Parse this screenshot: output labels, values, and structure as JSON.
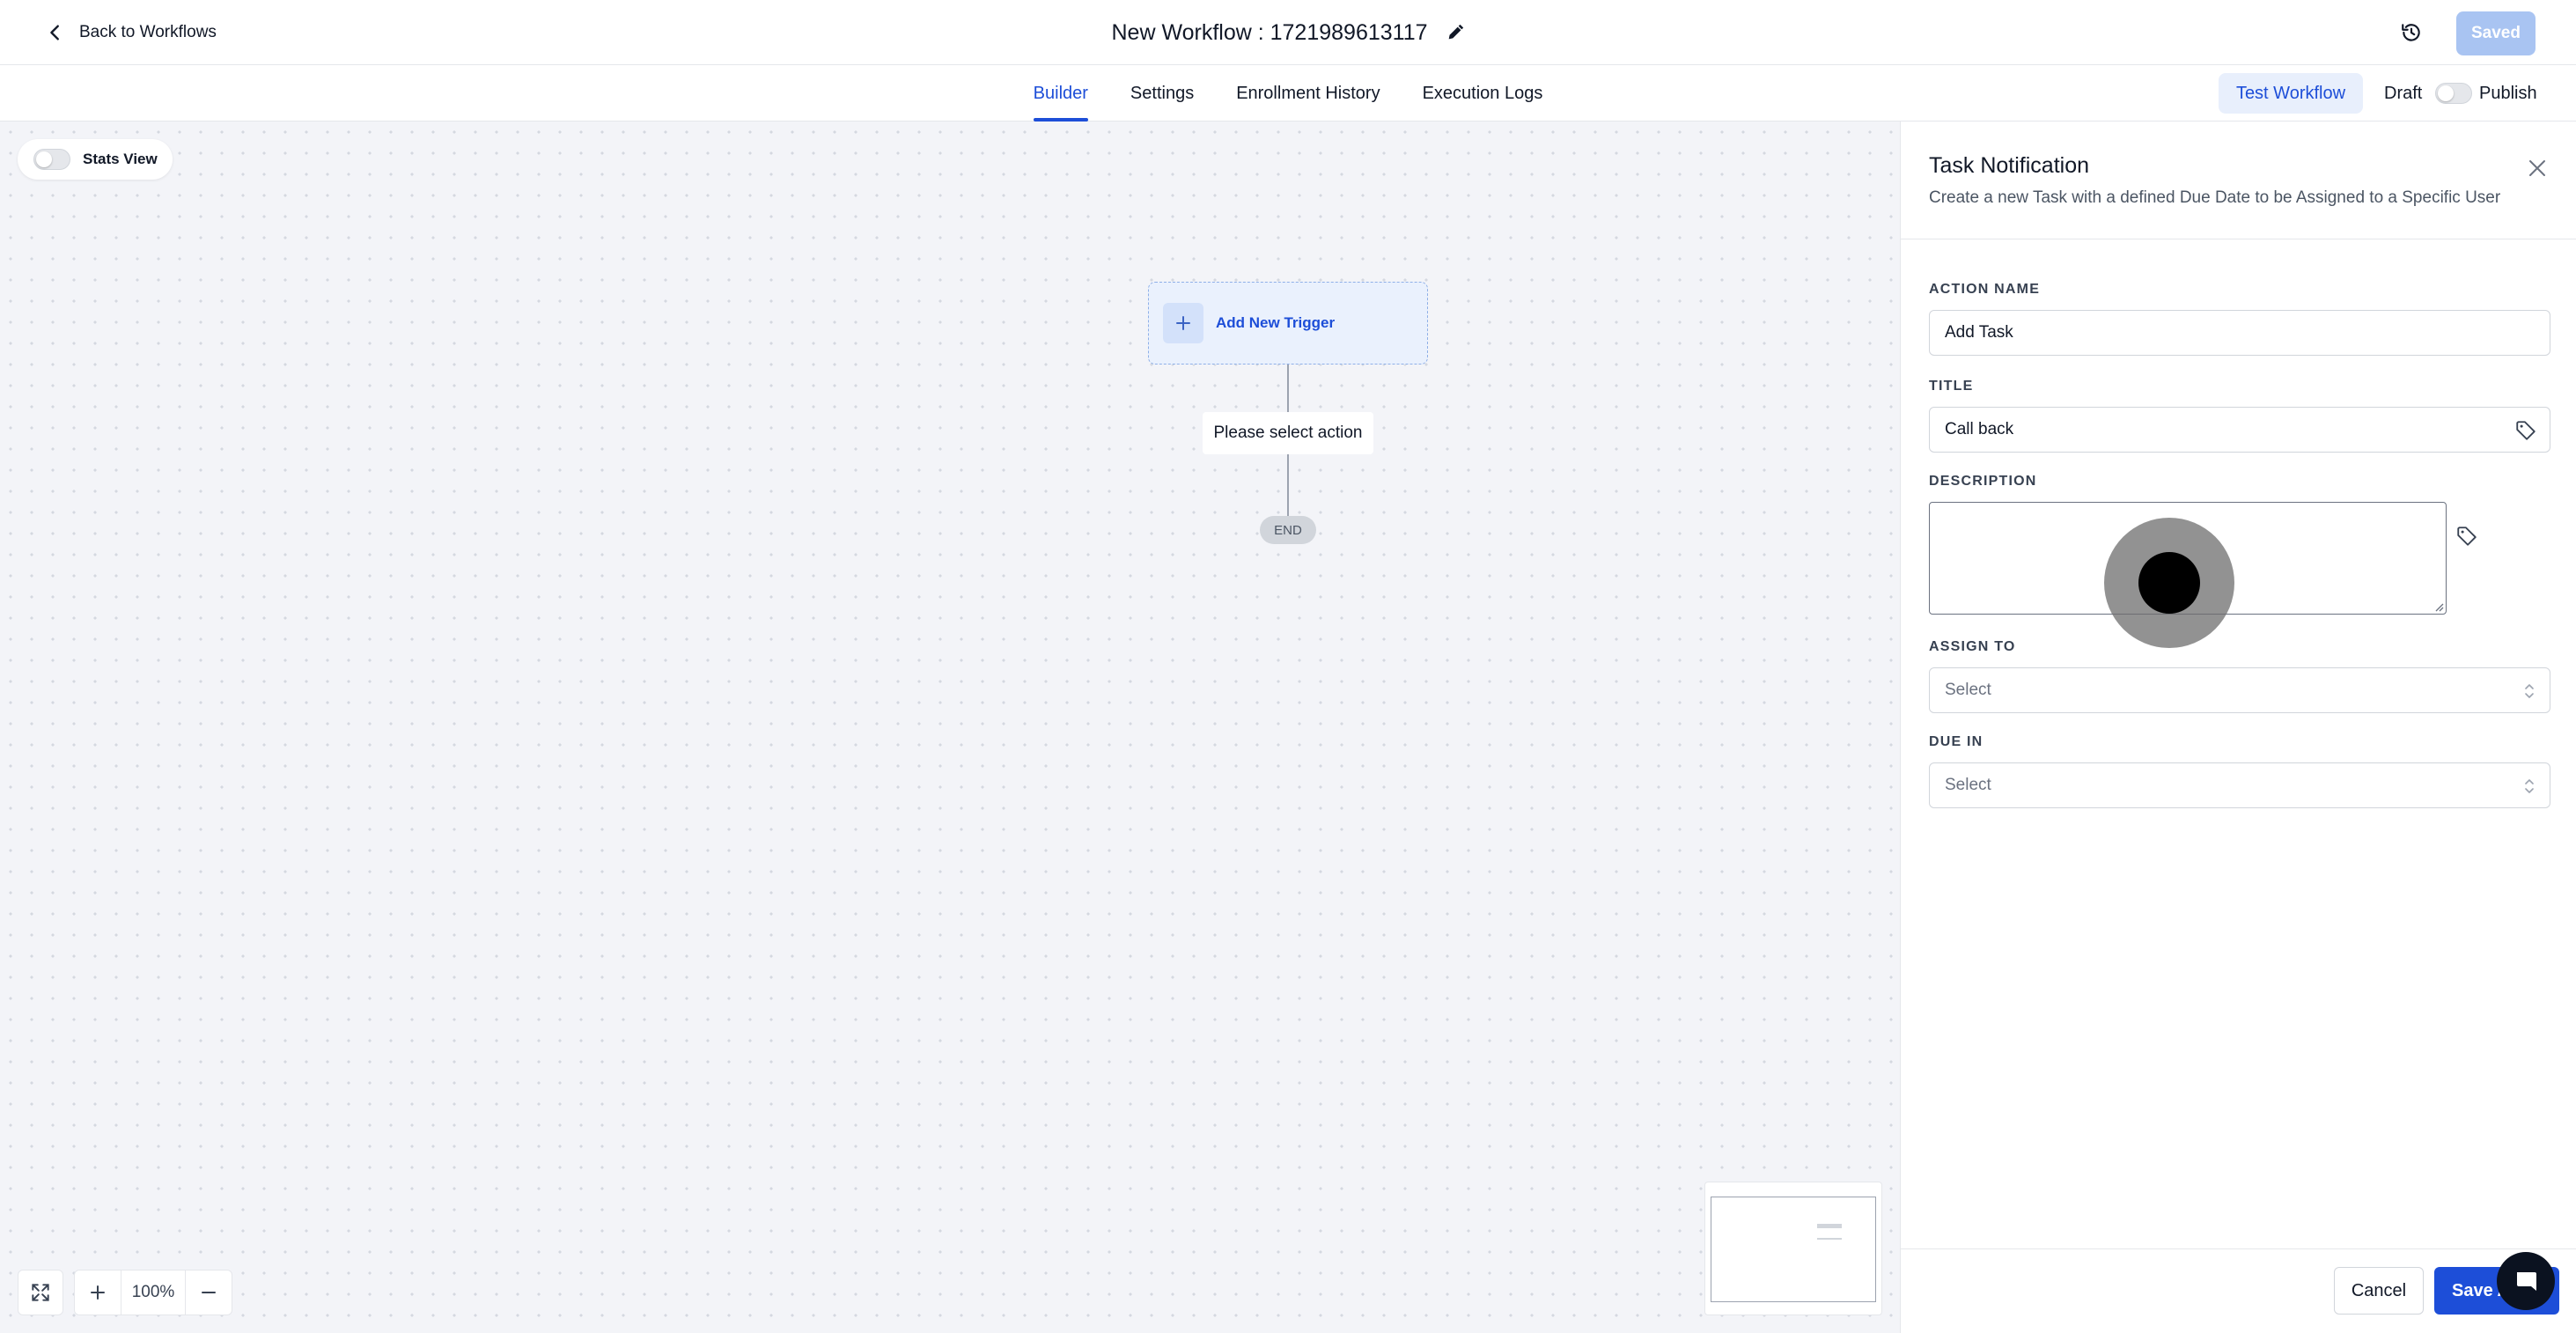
{
  "header": {
    "back_label": "Back to Workflows",
    "workflow_title": "New Workflow : 1721989613117",
    "saved_label": "Saved"
  },
  "tabs": [
    {
      "label": "Builder",
      "active": true
    },
    {
      "label": "Settings",
      "active": false
    },
    {
      "label": "Enrollment History",
      "active": false
    },
    {
      "label": "Execution Logs",
      "active": false
    }
  ],
  "toolbar": {
    "test_workflow_label": "Test Workflow",
    "draft_label": "Draft",
    "publish_label": "Publish",
    "publish_on": false
  },
  "canvas": {
    "stats_view_label": "Stats View",
    "stats_view_on": false,
    "trigger_label": "Add New Trigger",
    "action_placeholder": "Please select action",
    "end_label": "END",
    "zoom_level": "100%"
  },
  "panel": {
    "title": "Task Notification",
    "subtitle": "Create a new Task with a defined Due Date to be Assigned to a Specific User",
    "fields": {
      "action_name": {
        "label": "ACTION NAME",
        "value": "Add Task"
      },
      "title": {
        "label": "TITLE",
        "value": "Call back"
      },
      "description": {
        "label": "DESCRIPTION",
        "value": ""
      },
      "assign_to": {
        "label": "ASSIGN TO",
        "value": "Select"
      },
      "due_in": {
        "label": "DUE IN",
        "value": "Select"
      }
    },
    "cancel_label": "Cancel",
    "save_label": "Save Action"
  },
  "colors": {
    "accent": "#1d4ed8",
    "saved_button": "#a9c4f2",
    "canvas_bg": "#f3f4f8",
    "trigger_bg": "#eaf1fd"
  }
}
